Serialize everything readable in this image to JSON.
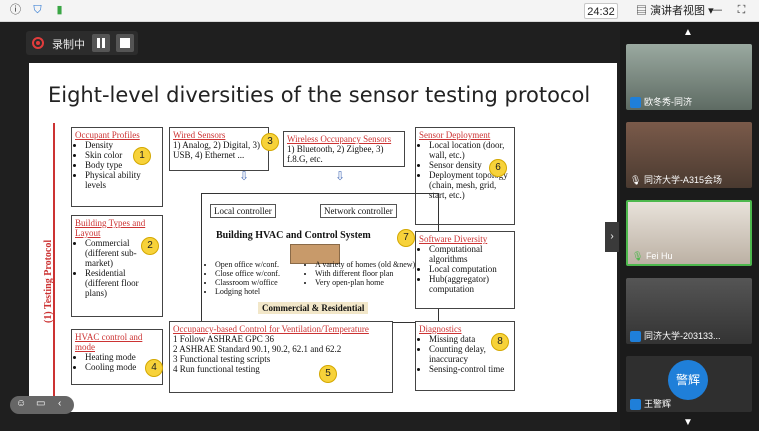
{
  "topbar": {
    "time": "24:32",
    "view_label": "演讲者视图",
    "icons": [
      "info-icon",
      "shield-icon",
      "signal-icon",
      "menu-icon",
      "minimize-icon",
      "fullscreen-icon"
    ]
  },
  "recording": {
    "label": "录制中"
  },
  "slide": {
    "title": "Eight-level diversities of the sensor testing protocol",
    "protocol_label": "(1) Testing Protocol",
    "boxes": {
      "occupant": {
        "num": "1",
        "header": "Occupant Profiles",
        "items": [
          "Density",
          "Skin color",
          "Body type",
          "Physical ability levels"
        ]
      },
      "building": {
        "num": "2",
        "header": "Building Types and Layout",
        "items": [
          "Commercial (different sub-market)",
          "Residential (different floor plans)"
        ]
      },
      "wired": {
        "num": "3",
        "header": "Wired Sensors",
        "text": "1) Analog, 2) Digital, 3) USB, 4) Ethernet ..."
      },
      "wireless": {
        "header": "Wireless Occupancy Sensors",
        "text": "1) Bluetooth, 2) Zigbee, 3) f.8.G, etc."
      },
      "deployment": {
        "num": "6",
        "header": "Sensor Deployment",
        "items": [
          "Local location (door, wall, etc.)",
          "Sensor density",
          "Deployment topology (chain, mesh, grid, start, etc.)"
        ]
      },
      "hvac_mode": {
        "num": "4",
        "header": "HVAC control and mode",
        "items": [
          "Heating mode",
          "Cooling mode"
        ]
      },
      "software": {
        "num": "7",
        "header": "Software Diversity",
        "items": [
          "Computational algorithms",
          "Local computation",
          "Hub(aggregator) computation"
        ]
      },
      "occupancy_control": {
        "num": "5",
        "header": "Occupancy-based Control for Ventilation/Temperature",
        "items": [
          "1   Follow ASHRAE GPC 36",
          "2   ASHRAE Standard 90.1, 90.2, 62.1 and 62.2",
          "3   Functional testing scripts",
          "4   Run functional testing"
        ]
      },
      "diagnostics": {
        "num": "8",
        "header": "Diagnostics",
        "items": [
          "Missing data",
          "Counting delay, inaccuracy",
          "Sensing-control time"
        ]
      }
    },
    "center": {
      "local_controller": "Local controller",
      "network_controller": "Network controller",
      "title": "Building HVAC and Control System",
      "left_items": [
        "Open office w/conf.",
        "Close office w/conf.",
        "Classroom w/office",
        "Lodging hotel"
      ],
      "right_items": [
        "A variety of homes (old &new)",
        "With different floor plan",
        "Very open-plan home"
      ],
      "footer": "Commercial & Residential"
    }
  },
  "participants": [
    {
      "name": "欧冬秀-同济"
    },
    {
      "name": "同济大学-A315会场"
    },
    {
      "name": "Fei Hu"
    },
    {
      "name": "同济大学-203133..."
    },
    {
      "name": "王警辉",
      "avatar_text": "警辉"
    }
  ],
  "colors": {
    "accent_red": "#cc3333",
    "badge_yellow": "#f7d23a",
    "active_border": "#4db84d",
    "avatar_blue": "#1f7fd9"
  }
}
